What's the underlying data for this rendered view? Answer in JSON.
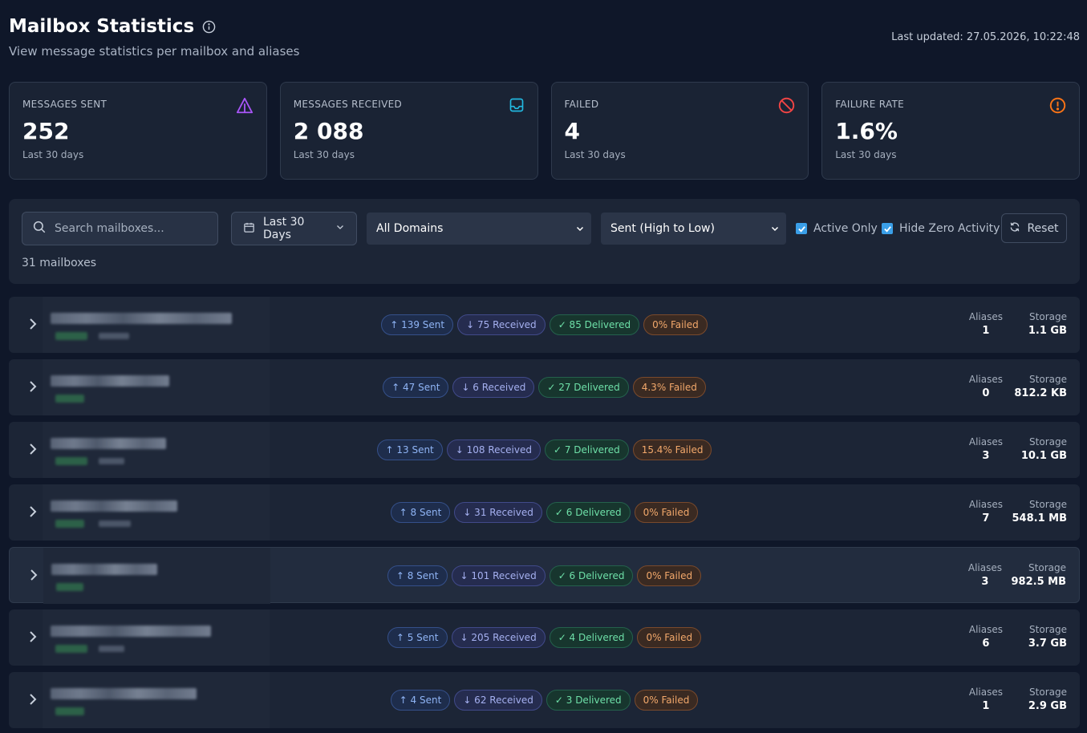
{
  "header": {
    "title": "Mailbox Statistics",
    "subtitle": "View message statistics per mailbox and aliases",
    "last_updated": "Last updated: 27.05.2026, 10:22:48"
  },
  "stats": [
    {
      "label": "MESSAGES SENT",
      "value": "252",
      "sub": "Last 30 days",
      "icon": "send-icon",
      "color": "#a855f7"
    },
    {
      "label": "MESSAGES RECEIVED",
      "value": "2 088",
      "sub": "Last 30 days",
      "icon": "inbox-icon",
      "color": "#22b8e0"
    },
    {
      "label": "FAILED",
      "value": "4",
      "sub": "Last 30 days",
      "icon": "ban-icon",
      "color": "#ef4444"
    },
    {
      "label": "FAILURE RATE",
      "value": "1.6%",
      "sub": "Last 30 days",
      "icon": "alert-icon",
      "color": "#f97316"
    }
  ],
  "filters": {
    "search_placeholder": "Search mailboxes...",
    "date_range": "Last 30 Days",
    "domain": "All Domains",
    "sort": "Sent (High to Low)",
    "active_only": "Active Only",
    "hide_zero": "Hide Zero Activity",
    "reset": "Reset",
    "count": "31 mailboxes"
  },
  "labels": {
    "aliases": "Aliases",
    "storage": "Storage"
  },
  "rows": [
    {
      "sent": "↑ 139 Sent",
      "received": "↓ 75 Received",
      "delivered": "✓ 85 Delivered",
      "failed": "0% Failed",
      "aliases": "1",
      "storage": "1.1 GB"
    },
    {
      "sent": "↑ 47 Sent",
      "received": "↓ 6 Received",
      "delivered": "✓ 27 Delivered",
      "failed": "4.3% Failed",
      "aliases": "0",
      "storage": "812.2 KB"
    },
    {
      "sent": "↑ 13 Sent",
      "received": "↓ 108 Received",
      "delivered": "✓ 7 Delivered",
      "failed": "15.4% Failed",
      "aliases": "3",
      "storage": "10.1 GB"
    },
    {
      "sent": "↑ 8 Sent",
      "received": "↓ 31 Received",
      "delivered": "✓ 6 Delivered",
      "failed": "0% Failed",
      "aliases": "7",
      "storage": "548.1 MB"
    },
    {
      "sent": "↑ 8 Sent",
      "received": "↓ 101 Received",
      "delivered": "✓ 6 Delivered",
      "failed": "0% Failed",
      "aliases": "3",
      "storage": "982.5 MB"
    },
    {
      "sent": "↑ 5 Sent",
      "received": "↓ 205 Received",
      "delivered": "✓ 4 Delivered",
      "failed": "0% Failed",
      "aliases": "6",
      "storage": "3.7 GB"
    },
    {
      "sent": "↑ 4 Sent",
      "received": "↓ 62 Received",
      "delivered": "✓ 3 Delivered",
      "failed": "0% Failed",
      "aliases": "1",
      "storage": "2.9 GB"
    }
  ]
}
